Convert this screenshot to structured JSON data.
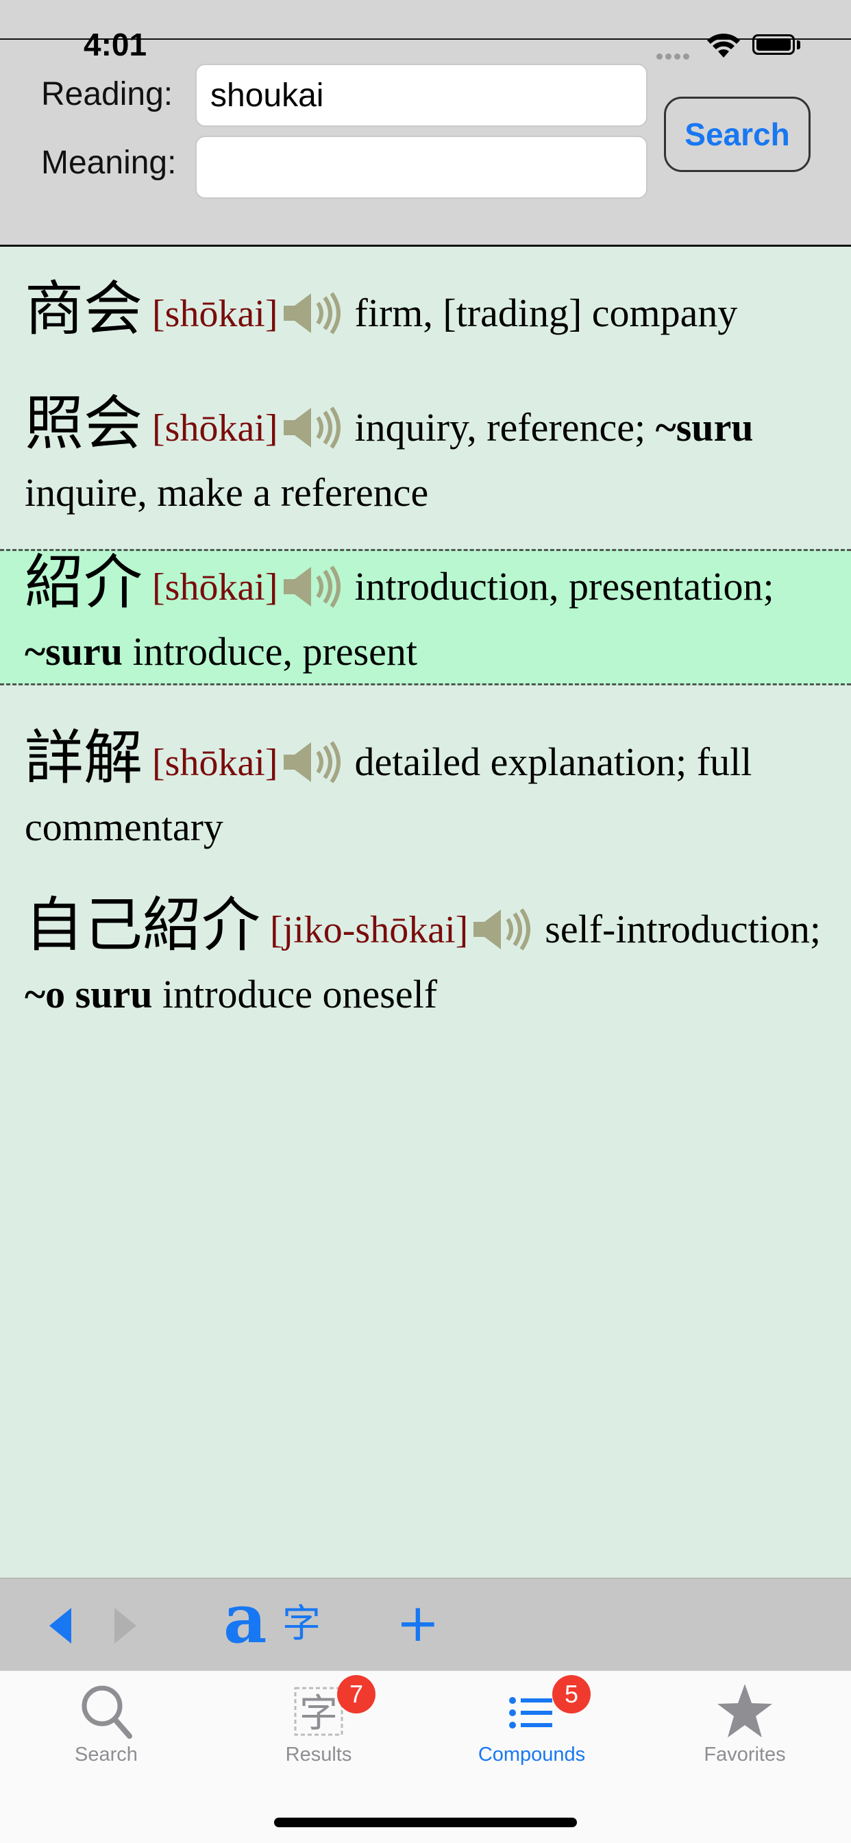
{
  "status_bar": {
    "time": "4:01"
  },
  "search_form": {
    "reading_label": "Reading:",
    "reading_value": "shoukai",
    "meaning_label": "Meaning:",
    "meaning_value": "",
    "search_button": "Search"
  },
  "entries": [
    {
      "kanji": "商会",
      "romaji": "[shōkai]",
      "gloss": "firm, [trading] company",
      "selected": false
    },
    {
      "kanji": "照会",
      "romaji": "[shōkai]",
      "gloss": "inquiry, reference;",
      "bold": "~suru",
      "gloss_after": "inquire, make a reference",
      "selected": false
    },
    {
      "kanji": "紹介",
      "romaji": "[shōkai]",
      "gloss": "introduction, presentation;",
      "bold": "~suru",
      "gloss_after": "introduce, present",
      "selected": true
    },
    {
      "kanji": "詳解",
      "romaji": "[shōkai]",
      "gloss": "detailed explanation; full commentary",
      "selected": false
    },
    {
      "kanji": "自己紹介",
      "romaji": "[jiko-shōkai]",
      "gloss": "self-introduction;",
      "bold": "~o suru",
      "gloss_after": "introduce oneself",
      "selected": false
    }
  ],
  "toolbar": {
    "romaji_toggle": "a",
    "kanji_toggle": "字",
    "add": "+"
  },
  "tabs": [
    {
      "label": "Search",
      "icon": "search-icon",
      "badge": ""
    },
    {
      "label": "Results",
      "icon": "kanji-results-icon",
      "badge": "7"
    },
    {
      "label": "Compounds",
      "icon": "list-icon",
      "badge": "5",
      "active": true
    },
    {
      "label": "Favorites",
      "icon": "star-icon",
      "badge": ""
    }
  ],
  "colors": {
    "accent": "#1877f2",
    "romaji": "#7a0b0b",
    "list_background": "#dceee4",
    "selected_background": "#b8f7cf",
    "badge": "#f03a2e",
    "speaker": "#a4a684"
  }
}
